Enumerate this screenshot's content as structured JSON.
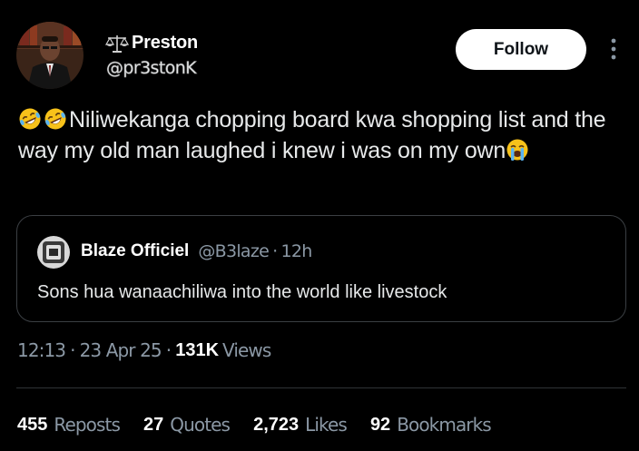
{
  "author": {
    "display_name": "Preston",
    "handle": "@pr3stonK",
    "badge_icon": "scales-of-justice-icon"
  },
  "actions": {
    "follow_label": "Follow",
    "more_icon": "more-vertical-icon"
  },
  "tweet": {
    "emoji_prefix": [
      "rolling-on-floor-laughing-emoji",
      "rolling-on-floor-laughing-emoji"
    ],
    "text": "Niliwekanga chopping board kwa shopping list and the way my old man laughed i knew i was on my own",
    "emoji_suffix": "loudly-crying-face-emoji"
  },
  "quote": {
    "display_name": "Blaze Officiel",
    "handle": "@B3laze",
    "separator": "·",
    "time": "12h",
    "text": "Sons hua wanaachiliwa into the world like livestock"
  },
  "meta": {
    "time": "12:13",
    "separator": "·",
    "date": "23 Apr 25",
    "views_count": "131K",
    "views_label": "Views"
  },
  "stats": [
    {
      "count": "455",
      "label": "Reposts"
    },
    {
      "count": "27",
      "label": "Quotes"
    },
    {
      "count": "2,723",
      "label": "Likes"
    },
    {
      "count": "92",
      "label": "Bookmarks"
    }
  ],
  "colors": {
    "background": "#000000",
    "text_primary": "#e7e9ea",
    "text_secondary": "#8b98a5",
    "border": "#2f3336",
    "follow_bg": "#ffffff"
  }
}
